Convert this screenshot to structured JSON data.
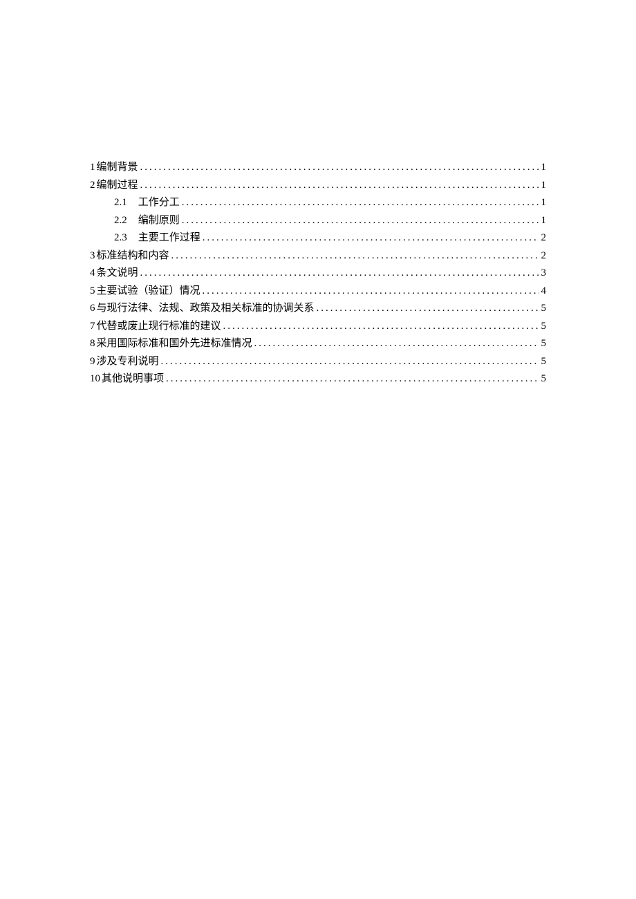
{
  "toc": [
    {
      "level": 1,
      "number": "1",
      "title": "编制背景",
      "page": "1"
    },
    {
      "level": 1,
      "number": "2",
      "title": "编制过程",
      "page": "1"
    },
    {
      "level": 2,
      "number": "2.1",
      "title": "工作分工",
      "page": "1"
    },
    {
      "level": 2,
      "number": "2.2",
      "title": "编制原则",
      "page": "1"
    },
    {
      "level": 2,
      "number": "2.3",
      "title": "主要工作过程",
      "page": "2"
    },
    {
      "level": 1,
      "number": "3",
      "title": "标准结构和内容",
      "page": "2"
    },
    {
      "level": 1,
      "number": "4",
      "title": "条文说明",
      "page": "3"
    },
    {
      "level": 1,
      "number": "5",
      "title": "主要试验（验证）情况",
      "page": "4"
    },
    {
      "level": 1,
      "number": "6",
      "title": "与现行法律、法规、政策及相关标准的协调关系",
      "page": "5"
    },
    {
      "level": 1,
      "number": "7",
      "title": "代替或废止现行标准的建议",
      "page": "5"
    },
    {
      "level": 1,
      "number": "8",
      "title": "采用国际标准和国外先进标准情况",
      "page": "5"
    },
    {
      "level": 1,
      "number": "9",
      "title": "涉及专利说明",
      "page": "5"
    },
    {
      "level": 1,
      "number": "10",
      "title": "其他说明事项",
      "page": "5"
    }
  ]
}
